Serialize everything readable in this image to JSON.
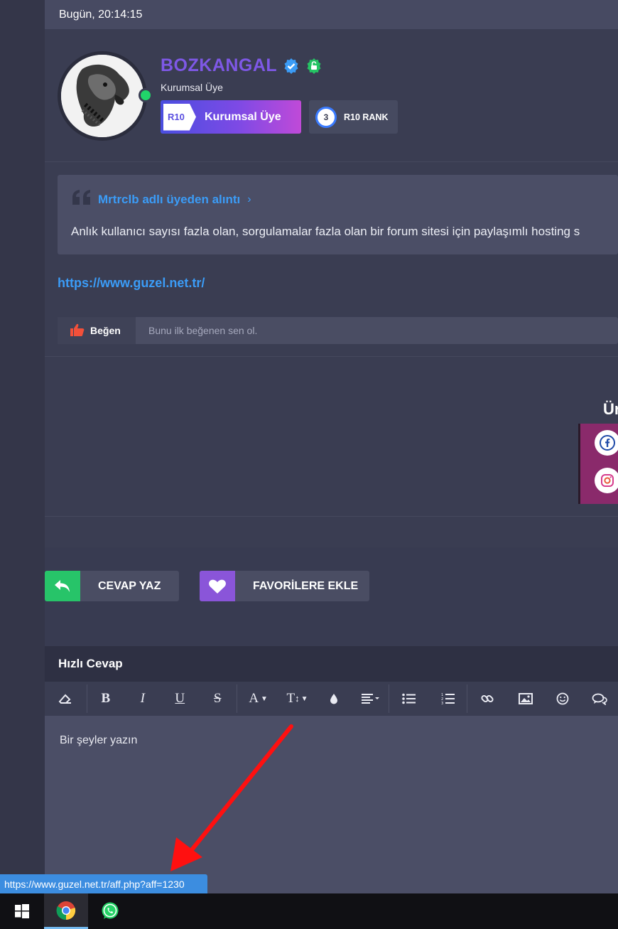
{
  "post": {
    "timestamp": "Bugün, 20:14:15",
    "username": "BOZKANGAL",
    "user_title": "Kurumsal Üye",
    "rank_badge": {
      "tag": "R10",
      "label": "Kurumsal Üye"
    },
    "rank_chip": {
      "number": "3",
      "label": "R10 RANK"
    },
    "quote": {
      "author": "Mrtrclb adlı üyeden alıntı",
      "chevron": "›",
      "text": "Anlık kullanıcı sayısı fazla olan, sorgulamalar fazla olan bir forum sitesi için paylaşımlı hosting s"
    },
    "link": "https://www.guzel.net.tr/",
    "like": {
      "button_label": "Beğen",
      "status_text": "Bunu ilk beğenen sen ol."
    },
    "signature_title": "Ür"
  },
  "actions": {
    "reply_label": "CEVAP YAZ",
    "favorite_label": "FAVORİLERE EKLE"
  },
  "quick_reply": {
    "title": "Hızlı Cevap",
    "placeholder": "Bir şeyler yazın",
    "toolbar": [
      "eraser-icon",
      "bold-icon",
      "italic-icon",
      "underline-icon",
      "strikethrough-icon",
      "font-color-icon",
      "font-size-icon",
      "color-drop-icon",
      "align-icon",
      "bullet-list-icon",
      "numbered-list-icon",
      "link-icon",
      "image-icon",
      "emoji-icon",
      "quote-icon"
    ]
  },
  "status_bar_url": "https://www.guzel.net.tr/aff.php?aff=1230",
  "colors": {
    "accent_blue": "#3b9cf7",
    "username_purple": "#7e58e6",
    "online_green": "#21d46a",
    "reply_green": "#27c469",
    "favorite_purple": "#8a55d9",
    "annotation_red": "#ff1010"
  }
}
